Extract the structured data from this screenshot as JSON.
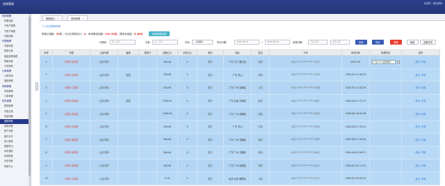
{
  "app": {
    "title": "系统管理",
    "top_right": "欢迎您 · 退出登录"
  },
  "sidebar": {
    "items": [
      {
        "label": "系统管理",
        "type": "group"
      },
      {
        "label": "权限设置",
        "type": "item"
      },
      {
        "label": "子用户管理",
        "type": "item"
      },
      {
        "label": "子账户管理",
        "type": "item"
      },
      {
        "label": "代理设置",
        "type": "item"
      },
      {
        "label": "代理管理",
        "type": "group"
      },
      {
        "label": "代理列表",
        "type": "item"
      },
      {
        "label": "提现记录",
        "type": "item"
      },
      {
        "label": "佣金结算管理",
        "type": "item"
      },
      {
        "label": "等级设置",
        "type": "item"
      },
      {
        "label": "分成规则",
        "type": "item"
      },
      {
        "label": "订单管理",
        "type": "group"
      },
      {
        "label": "订单查询",
        "type": "item"
      },
      {
        "label": "退款管理",
        "type": "item"
      },
      {
        "label": "商城管理",
        "type": "group"
      },
      {
        "label": "商品管理",
        "type": "item"
      },
      {
        "label": "订单管理",
        "type": "item"
      },
      {
        "label": "财务管理",
        "type": "group"
      },
      {
        "label": "提现管理",
        "type": "item"
      },
      {
        "label": "充值记录",
        "type": "item"
      },
      {
        "label": "资金明细",
        "type": "item"
      },
      {
        "label": "提现审核",
        "type": "item",
        "active": true
      },
      {
        "label": "结算设置",
        "type": "item"
      },
      {
        "label": "账户设置",
        "type": "item"
      },
      {
        "label": "操作日志",
        "type": "item"
      },
      {
        "label": "统计报表",
        "type": "item"
      },
      {
        "label": "数据导出",
        "type": "item"
      },
      {
        "label": "消息通知",
        "type": "item"
      },
      {
        "label": "系统配置",
        "type": "item"
      },
      {
        "label": "安全设置",
        "type": "item"
      },
      {
        "label": "帮助中心",
        "type": "item"
      }
    ]
  },
  "tabs": [
    {
      "label": "数据统计",
      "active": false
    },
    {
      "label": "提现管理",
      "active": true
    }
  ],
  "page": {
    "link": "三十天内提现申请",
    "summary": {
      "p1": "提现记录数：",
      "count": "33",
      "p2": "条，今日已提现总计：",
      "today": "0",
      "p3": "，申请提现总额：",
      "total": "131.92元",
      "p4": "，提现手续费：",
      "fee": "5.38元",
      "action": "批量提现处理"
    }
  },
  "filters": {
    "agent_label": "代理商:",
    "agent_placeholder": "输入名称",
    "phone_label": "手机:",
    "phone_placeholder": "输入号码",
    "status_label": "状态:",
    "status_value": "—请选择—",
    "apply_label": "申请日期:",
    "date_from": "2020-05-01",
    "date_sep": "—",
    "date_to": "2020-06-01",
    "process_label": "处理日期:",
    "process_from": "开始日期",
    "process_to": "结束日期",
    "search": "查询",
    "export": "导出",
    "reset": "重置",
    "refresh": "刷新",
    "more": "查看详情"
  },
  "table": {
    "columns": [
      "序号",
      "代理",
      "上级代理",
      "客服",
      "提现卡",
      "金额(元)",
      "手续(元)",
      "银行",
      "地区",
      "姓名",
      "卡号",
      "申请时间",
      "处理状态",
      "操作"
    ],
    "rows": [
      {
        "no": "1",
        "agent": "(代理) 张某某",
        "parent": "上级代理A",
        "service": "",
        "card": "",
        "amount": "200.00",
        "fee": "0",
        "bank": "银行",
        "region": "广东 江门 蓬江区",
        "name": "张某",
        "cardno": "6222 **** **** **** 1234",
        "time": "2020-05-",
        "status_select": "广东/广州 招商银行",
        "ops": [
          "成功",
          "失败"
        ]
      },
      {
        "no": "2",
        "agent": "(代理) 李某某",
        "parent": "上级代理B",
        "service": "客服",
        "card": "",
        "amount": "100.00",
        "fee": "0",
        "bank": "银行",
        "region": "广东 中山",
        "name": "李某",
        "cardno": "6222 **** **** **** 2345",
        "time": "2020-05-19 00:53",
        "status_select": "",
        "ops": [
          "成功",
          "失败"
        ]
      },
      {
        "no": "3",
        "agent": "(代理) 王某某",
        "parent": "上级代理C",
        "service": "",
        "card": "",
        "amount": "100.00",
        "fee": "0",
        "bank": "银行",
        "region": "广东 广州 增城区",
        "name": "王某",
        "cardno": "6222 **** **** **** 3456",
        "time": "2020-05-22 03:16",
        "status_select": "",
        "ops": [
          "成功",
          "失败"
        ]
      },
      {
        "no": "4",
        "agent": "(代理) 赵某某",
        "parent": "上级代理D",
        "service": "客服",
        "card": "",
        "amount": "2700.03",
        "fee": "0",
        "bank": "银行",
        "region": "广东 清远 清城区",
        "name": "赵某",
        "cardno": "6222 **** **** **** 4567",
        "time": "2020-06-15 21:13",
        "status_select": "",
        "ops": [
          "成功",
          "失败"
        ]
      },
      {
        "no": "5",
        "agent": "(代理) 钱某某",
        "parent": "上级代理E",
        "service": "",
        "card": "",
        "amount": "1400.00",
        "fee": "0",
        "bank": "银行",
        "region": "广东 广州 增城区",
        "name": "钱某",
        "cardno": "6222 **** **** **** 5678",
        "time": "2020-06-18 05:36",
        "status_select": "",
        "ops": [
          "成功",
          "失败"
        ]
      },
      {
        "no": "6",
        "agent": "(代理) 孙某某",
        "parent": "上级代理F",
        "service": "",
        "card": "",
        "amount": "200.00",
        "fee": "0",
        "bank": "银行",
        "region": "广东 中山",
        "name": "孙某",
        "cardno": "6222 **** **** **** 6789",
        "time": "2020-06-17 20:24",
        "status_select": "",
        "ops": [
          "成功",
          "失败"
        ]
      },
      {
        "no": "7",
        "agent": "(代理) 周某某",
        "parent": "上级代理G",
        "service": "",
        "card": "",
        "amount": "500.00",
        "fee": "0",
        "bank": "银行",
        "region": "广东 广州 花都区",
        "name": "周某",
        "cardno": "6222 **** **** **** 7890",
        "time": "2020-06-17 03:44",
        "status_select": "",
        "ops": [
          "成功",
          "失败"
        ]
      },
      {
        "no": "8",
        "agent": "(代理) 吴某某",
        "parent": "上级代理H",
        "service": "",
        "card": "",
        "amount": "300.00",
        "fee": "0",
        "bank": "银行",
        "region": "广东 广州 花都区",
        "name": "吴某",
        "cardno": "6222 **** **** **** 8901",
        "time": "2020-06-02 09:37",
        "status_select": "",
        "ops": [
          "成功",
          "失败"
        ]
      },
      {
        "no": "9",
        "agent": "(代理) 郑某某",
        "parent": "上级代理I",
        "service": "",
        "card": "",
        "amount": "200.00",
        "fee": "0",
        "bank": "银行",
        "region": "广东 广州 增城区",
        "name": "郑某",
        "cardno": "6222 **** **** **** 9012",
        "time": "2020-05-25 11:52",
        "status_select": "",
        "ops": [
          "成功",
          "失败"
        ]
      },
      {
        "no": "10",
        "agent": "(代理) 冯某某",
        "parent": "上级代理J",
        "service": "",
        "card": "",
        "amount": "0.10",
        "fee": "0",
        "bank": "银行",
        "region": "北京 北京 朝阳区",
        "name": "冯某",
        "cardno": "6222 **** **** **** 0123",
        "time": "2020-04-30 05:29",
        "status_select": "",
        "ops": [
          "成功",
          "失败"
        ]
      }
    ]
  }
}
